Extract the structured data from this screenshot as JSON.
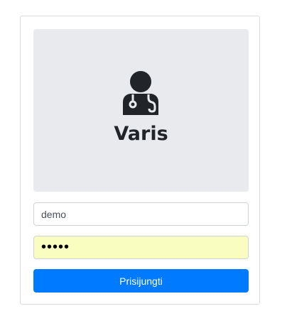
{
  "brand": {
    "name": "Varis",
    "icon": "user-doctor-icon"
  },
  "form": {
    "username_value": "demo",
    "password_value": "demo1",
    "submit_label": "Prisijungti"
  },
  "colors": {
    "banner_bg": "#e9eaee",
    "button_bg": "#007bff",
    "password_autofill_bg": "#fafdc0",
    "text_dark": "#212529"
  }
}
